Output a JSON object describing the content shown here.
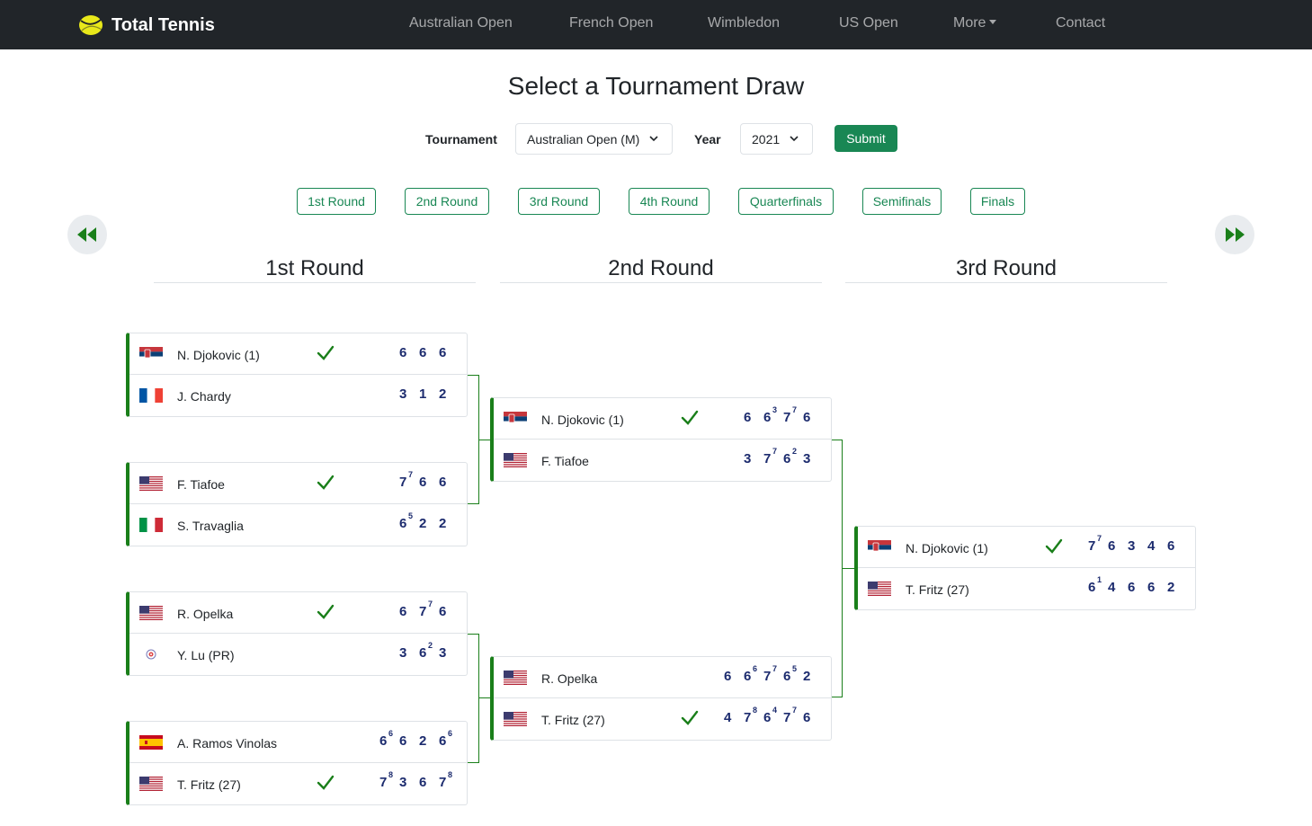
{
  "nav": {
    "brand": "Total Tennis",
    "links": [
      "Australian Open",
      "French Open",
      "Wimbledon",
      "US Open",
      "More",
      "Contact"
    ]
  },
  "page": {
    "title": "Select a Tournament Draw",
    "tournament_label": "Tournament",
    "tournament_value": "Australian Open (M)",
    "year_label": "Year",
    "year_value": "2021",
    "submit_label": "Submit"
  },
  "round_buttons": [
    "1st Round",
    "2nd Round",
    "3rd Round",
    "4th Round",
    "Quarterfinals",
    "Semifinals",
    "Finals"
  ],
  "round_titles": [
    "1st Round",
    "2nd Round",
    "3rd Round"
  ],
  "colors": {
    "accent": "#198754",
    "bracket": "#1a7f1a",
    "score": "#1c2b6e",
    "navbar": "#212529"
  },
  "matches": [
    {
      "round": 1,
      "players": [
        {
          "name": "N. Djokovic (1)",
          "flag": "serbia",
          "winner": true,
          "scores": [
            [
              "6",
              ""
            ],
            [
              "6",
              ""
            ],
            [
              "6",
              ""
            ]
          ]
        },
        {
          "name": "J. Chardy",
          "flag": "france",
          "winner": false,
          "scores": [
            [
              "3",
              ""
            ],
            [
              "1",
              ""
            ],
            [
              "2",
              ""
            ]
          ]
        }
      ]
    },
    {
      "round": 1,
      "players": [
        {
          "name": "F. Tiafoe",
          "flag": "usa",
          "winner": true,
          "scores": [
            [
              "7",
              "7"
            ],
            [
              "6",
              ""
            ],
            [
              "6",
              ""
            ]
          ]
        },
        {
          "name": "S. Travaglia",
          "flag": "italy",
          "winner": false,
          "scores": [
            [
              "6",
              "5"
            ],
            [
              "2",
              ""
            ],
            [
              "2",
              ""
            ]
          ]
        }
      ]
    },
    {
      "round": 1,
      "players": [
        {
          "name": "R. Opelka",
          "flag": "usa",
          "winner": true,
          "scores": [
            [
              "6",
              ""
            ],
            [
              "7",
              "7"
            ],
            [
              "6",
              ""
            ]
          ]
        },
        {
          "name": "Y. Lu (PR)",
          "flag": "taipei",
          "winner": false,
          "scores": [
            [
              "3",
              ""
            ],
            [
              "6",
              "2"
            ],
            [
              "3",
              ""
            ]
          ]
        }
      ]
    },
    {
      "round": 1,
      "players": [
        {
          "name": "A. Ramos Vinolas",
          "flag": "spain",
          "winner": false,
          "scores": [
            [
              "6",
              "6"
            ],
            [
              "6",
              ""
            ],
            [
              "2",
              ""
            ],
            [
              "6",
              "6"
            ]
          ]
        },
        {
          "name": "T. Fritz (27)",
          "flag": "usa",
          "winner": true,
          "scores": [
            [
              "7",
              "8"
            ],
            [
              "3",
              ""
            ],
            [
              "6",
              ""
            ],
            [
              "7",
              "8"
            ]
          ]
        }
      ]
    },
    {
      "round": 2,
      "players": [
        {
          "name": "N. Djokovic (1)",
          "flag": "serbia",
          "winner": true,
          "scores": [
            [
              "6",
              ""
            ],
            [
              "6",
              "3"
            ],
            [
              "7",
              "7"
            ],
            [
              "6",
              ""
            ]
          ]
        },
        {
          "name": "F. Tiafoe",
          "flag": "usa",
          "winner": false,
          "scores": [
            [
              "3",
              ""
            ],
            [
              "7",
              "7"
            ],
            [
              "6",
              "2"
            ],
            [
              "3",
              ""
            ]
          ]
        }
      ]
    },
    {
      "round": 2,
      "players": [
        {
          "name": "R. Opelka",
          "flag": "usa",
          "winner": false,
          "scores": [
            [
              "6",
              ""
            ],
            [
              "6",
              "6"
            ],
            [
              "7",
              "7"
            ],
            [
              "6",
              "5"
            ],
            [
              "2",
              ""
            ]
          ]
        },
        {
          "name": "T. Fritz (27)",
          "flag": "usa",
          "winner": true,
          "scores": [
            [
              "4",
              ""
            ],
            [
              "7",
              "8"
            ],
            [
              "6",
              "4"
            ],
            [
              "7",
              "7"
            ],
            [
              "6",
              ""
            ]
          ]
        }
      ]
    },
    {
      "round": 3,
      "players": [
        {
          "name": "N. Djokovic (1)",
          "flag": "serbia",
          "winner": true,
          "scores": [
            [
              "7",
              "7"
            ],
            [
              "6",
              ""
            ],
            [
              "3",
              ""
            ],
            [
              "4",
              ""
            ],
            [
              "6",
              ""
            ]
          ]
        },
        {
          "name": "T. Fritz (27)",
          "flag": "usa",
          "winner": false,
          "scores": [
            [
              "6",
              "1"
            ],
            [
              "4",
              ""
            ],
            [
              "6",
              ""
            ],
            [
              "6",
              ""
            ],
            [
              "2",
              ""
            ]
          ]
        }
      ]
    }
  ]
}
